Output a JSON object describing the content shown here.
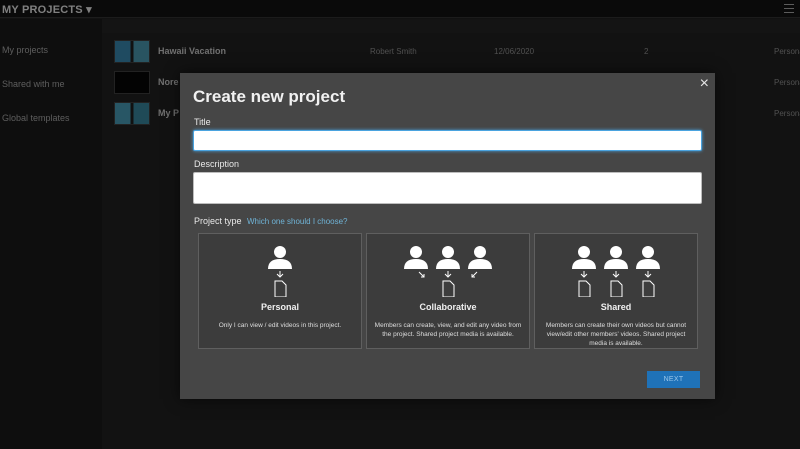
{
  "header": {
    "title": "MY PROJECTS ▾"
  },
  "sidebar": {
    "items": [
      {
        "label": "My projects"
      },
      {
        "label": "Shared with me"
      },
      {
        "label": "Global templates"
      }
    ]
  },
  "projects": [
    {
      "title": "Hawaii Vacation",
      "owner": "Robert Smith",
      "date": "12/06/2020",
      "count": "2",
      "action": "Personal"
    },
    {
      "title": "Nore",
      "owner": "",
      "date": "",
      "count": "",
      "action": "Personal"
    },
    {
      "title": "My P",
      "owner": "",
      "date": "",
      "count": "",
      "action": "Personal"
    }
  ],
  "modal": {
    "title": "Create new project",
    "close": "×",
    "title_label": "Title",
    "description_label": "Description",
    "project_type_label": "Project type",
    "help_link": "Which one should I choose?",
    "types": [
      {
        "name": "Personal",
        "desc": "Only I can view / edit videos in this project."
      },
      {
        "name": "Collaborative",
        "desc": "Members can create, view, and edit any video from the project. Shared project media is available."
      },
      {
        "name": "Shared",
        "desc": "Members can create their own videos but cannot view/edit other members' videos. Shared project media is available."
      }
    ],
    "next_label": "NEXT"
  },
  "colors": {
    "accent": "#1f72b8",
    "link": "#6fb3d6",
    "modal_bg": "#464646"
  }
}
